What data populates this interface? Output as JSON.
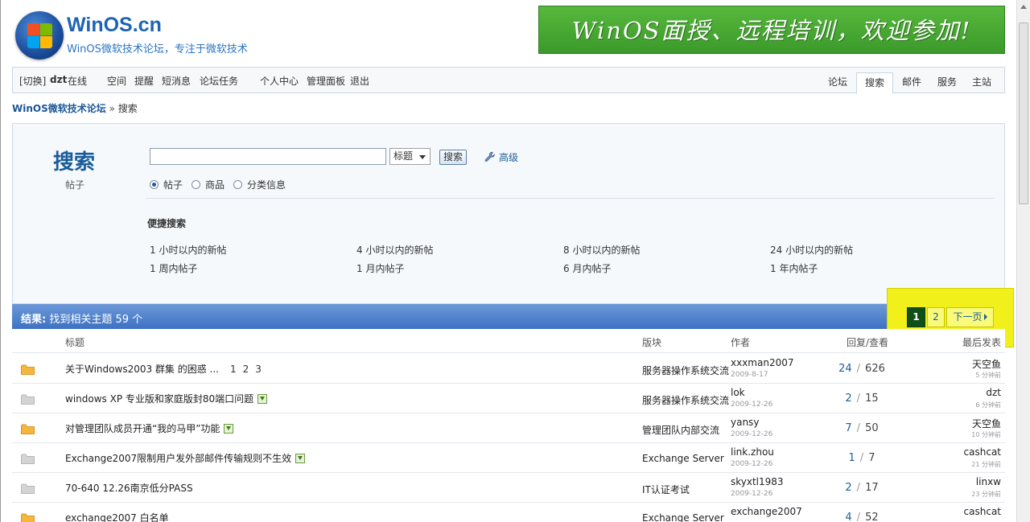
{
  "header": {
    "brand_name": "WinOS.cn",
    "brand_slogan": "WinOS微软技术论坛，专注于微软技术",
    "banner_text": "WinOS面授、远程培训，欢迎参加!"
  },
  "userbar": {
    "switch_label": "[切换]",
    "username": "dzt",
    "online_label": "在线",
    "links": [
      "空间",
      "提醒",
      "短消息",
      "论坛任务",
      "个人中心",
      "管理面板",
      "退出"
    ]
  },
  "nav_tabs": [
    {
      "label": "论坛",
      "active": false
    },
    {
      "label": "搜索",
      "active": true
    },
    {
      "label": "邮件",
      "active": false
    },
    {
      "label": "服务",
      "active": false
    },
    {
      "label": "主站",
      "active": false
    }
  ],
  "breadcrumb": {
    "home": "WinOS微软技术论坛",
    "separator": "»",
    "current": "搜索"
  },
  "search": {
    "title": "搜索",
    "subtitle": "帖子",
    "input_value": "",
    "select_value": "标题",
    "button_label": "搜索",
    "advanced_label": "高级",
    "types": [
      {
        "label": "帖子",
        "checked": true
      },
      {
        "label": "商品",
        "checked": false
      },
      {
        "label": "分类信息",
        "checked": false
      }
    ],
    "quick_title": "便捷搜索",
    "quick_links": [
      "1 小时以内的新帖",
      "4 小时以内的新帖",
      "8 小时以内的新帖",
      "24 小时以内的新帖",
      "1 周内帖子",
      "1 月内帖子",
      "6 月内帖子",
      "1 年内帖子"
    ]
  },
  "results": {
    "label": "结果:",
    "summary": "找到相关主题 59 个"
  },
  "pager": {
    "pages": [
      "1",
      "2"
    ],
    "current": "1",
    "next_label": "下一页"
  },
  "table": {
    "columns": {
      "title": "标题",
      "forum": "版块",
      "author": "作者",
      "stats": "回复/查看",
      "last": "最后发表"
    },
    "rows": [
      {
        "title": "关于Windows2003 群集 的困惑 ...",
        "pages": [
          "1",
          "2",
          "3"
        ],
        "attach": false,
        "hot": true,
        "forum": "服务器操作系统交流",
        "author": "xxxman2007",
        "date": "2009-8-17",
        "replies": "24",
        "views": "626",
        "last_user": "天空鱼",
        "last_time": "5 分钟前"
      },
      {
        "title": "windows XP 专业版和家庭版封80端口问题",
        "pages": [],
        "attach": true,
        "hot": false,
        "forum": "服务器操作系统交流",
        "author": "lok",
        "date": "2009-12-26",
        "replies": "2",
        "views": "15",
        "last_user": "dzt",
        "last_time": "6 分钟前"
      },
      {
        "title": "对管理团队成员开通“我的马甲”功能",
        "pages": [],
        "attach": true,
        "hot": true,
        "forum": "管理团队内部交流",
        "author": "yansy",
        "date": "2009-12-26",
        "replies": "7",
        "views": "50",
        "last_user": "天空鱼",
        "last_time": "10 分钟前"
      },
      {
        "title": "Exchange2007限制用户发外部邮件传输规则不生效",
        "pages": [],
        "attach": true,
        "hot": false,
        "forum": "Exchange Server",
        "author": "link.zhou",
        "date": "2009-12-26",
        "replies": "1",
        "views": "7",
        "last_user": "cashcat",
        "last_time": "21 分钟前"
      },
      {
        "title": "70-640 12.26南京低分PASS",
        "pages": [],
        "attach": false,
        "hot": false,
        "forum": "IT认证考试",
        "author": "skyxtl1983",
        "date": "2009-12-26",
        "replies": "2",
        "views": "17",
        "last_user": "linxw",
        "last_time": "23 分钟前"
      },
      {
        "title": "exchange2007 白名单",
        "pages": [],
        "attach": false,
        "hot": true,
        "forum": "Exchange Server",
        "author": "exchange2007",
        "date": "",
        "replies": "4",
        "views": "52",
        "last_user": "cashcat",
        "last_time": ""
      }
    ]
  },
  "colors": {
    "brand_blue": "#1c64b5",
    "results_bar": "#3d72c3",
    "highlight": "#f2f01a",
    "pager_current": "#114f18",
    "banner_green": "#3b9a2a"
  }
}
